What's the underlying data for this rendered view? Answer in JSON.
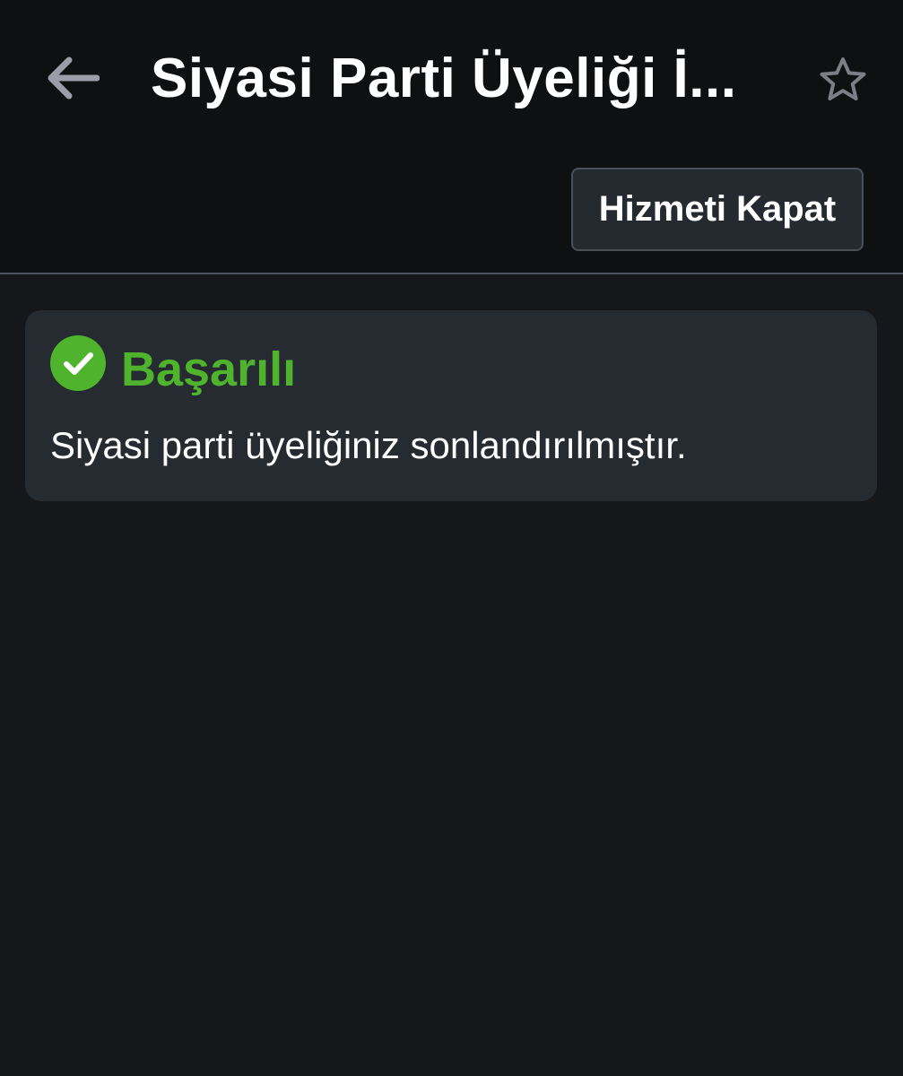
{
  "header": {
    "title": "Siyasi Parti Üyeliği İ...",
    "back_icon": "arrow-left-icon",
    "favorite_icon": "star-outline-icon",
    "close_service_label": "Hizmeti Kapat"
  },
  "alert": {
    "status_icon": "check-circle-icon",
    "title": "Başarılı",
    "message": "Siyasi parti üyeliğiniz sonlandırılmıştır.",
    "accent_color": "#4fb32d"
  },
  "colors": {
    "background": "#16171a",
    "header_background": "#0f1011",
    "card_background": "#262a31",
    "button_background": "#252a31",
    "text": "#ffffff"
  }
}
